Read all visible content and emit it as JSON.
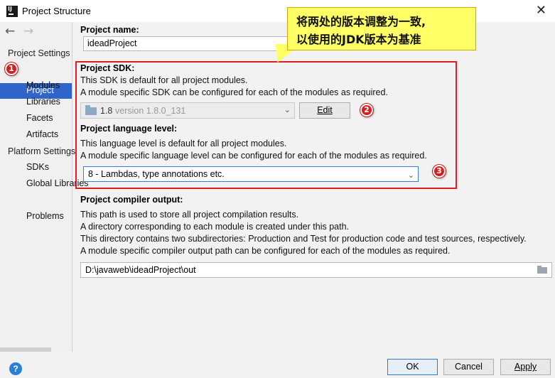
{
  "window": {
    "title": "Project Structure"
  },
  "sidebar": {
    "back_icon": "arrow-left-icon",
    "forward_icon": "arrow-right-icon",
    "project_settings_label": "Project Settings",
    "project_settings_items": [
      "Project",
      "Modules",
      "Libraries",
      "Facets",
      "Artifacts"
    ],
    "platform_settings_label": "Platform Settings",
    "platform_settings_items": [
      "SDKs",
      "Global Libraries"
    ],
    "problems_label": "Problems",
    "selected": "Project"
  },
  "main": {
    "project_name_label": "Project name:",
    "project_name_value": "ideadProject",
    "sdk": {
      "heading": "Project SDK:",
      "desc1": "This SDK is default for all project modules.",
      "desc2": "A module specific SDK can be configured for each of the modules as required.",
      "selected_name": "1.8",
      "selected_version": "version 1.8.0_131",
      "edit_label": "Edit"
    },
    "language": {
      "heading": "Project language level:",
      "desc1": "This language level is default for all project modules.",
      "desc2": "A module specific language level can be configured for each of the modules as required.",
      "selected": "8 - Lambdas, type annotations etc."
    },
    "compiler": {
      "heading": "Project compiler output:",
      "desc1": "This path is used to store all project compilation results.",
      "desc2": "A directory corresponding to each module is created under this path.",
      "desc3": "This directory contains two subdirectories: Production and Test for production code and test sources, respectively.",
      "desc4": "A module specific compiler output path can be configured for each of the modules as required.",
      "path": "D:\\javaweb\\ideadProject\\out"
    }
  },
  "annotation": {
    "line1": "将两处的版本调整为一致,",
    "line2": "以使用的JDK版本为基准",
    "markers": [
      "1",
      "2",
      "3"
    ],
    "highlight_color": "#e02020",
    "callout_color": "#ffff66"
  },
  "footer": {
    "ok_label": "OK",
    "cancel_label": "Cancel",
    "apply_label": "Apply",
    "help_icon": "help-icon"
  }
}
